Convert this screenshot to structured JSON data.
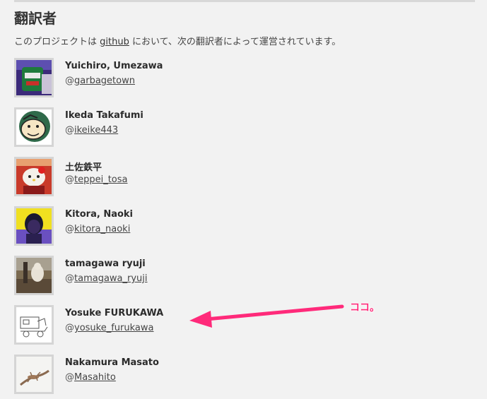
{
  "page": {
    "title": "翻訳者",
    "intro_before": "このプロジェクトは ",
    "intro_link": "github",
    "intro_after": " において、次の翻訳者によって運営されています。"
  },
  "translators": [
    {
      "name": "Yuichiro, Umezawa",
      "handle_prefix": "@",
      "handle": "garbagetown",
      "avatar": "can-photo"
    },
    {
      "name": "Ikeda Takafumi",
      "handle_prefix": "@",
      "handle": "ikeike443",
      "avatar": "cartoon-face"
    },
    {
      "name": "土佐鉄平",
      "handle_prefix": "@",
      "handle": "teppei_tosa",
      "avatar": "red-character"
    },
    {
      "name": "Kitora, Naoki",
      "handle_prefix": "@",
      "handle": "kitora_naoki",
      "avatar": "person-yellow-bg"
    },
    {
      "name": "tamagawa ryuji",
      "handle_prefix": "@",
      "handle": "tamagawa_ryuji",
      "avatar": "cat-photo"
    },
    {
      "name": "Yosuke FURUKAWA",
      "handle_prefix": "@",
      "handle": "yosuke_furukawa",
      "avatar": "sketch-drawing"
    },
    {
      "name": "Nakamura Masato",
      "handle_prefix": "@",
      "handle": "Masahito",
      "avatar": "gecko-photo"
    }
  ],
  "annotation": {
    "text": "ココ。",
    "color": "#ff2a7a"
  }
}
